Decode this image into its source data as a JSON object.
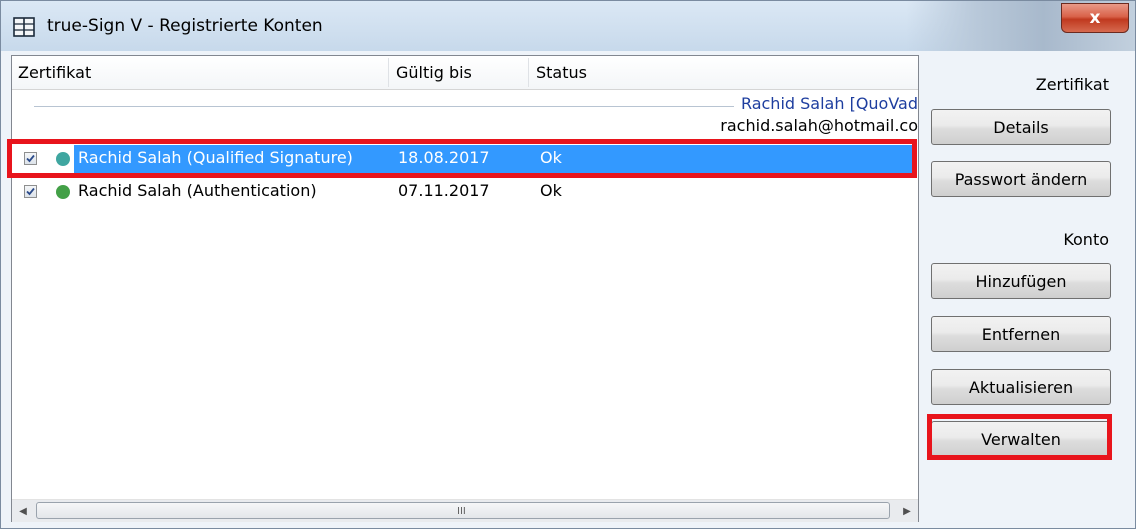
{
  "window": {
    "title": "true-Sign V - Registrierte Konten",
    "close_glyph": "x"
  },
  "list": {
    "columns": [
      {
        "label": "Zertifikat"
      },
      {
        "label": "Gültig bis"
      },
      {
        "label": "Status"
      }
    ],
    "group": {
      "name": "Rachid Salah [QuoVad",
      "email": "rachid.salah@hotmail.co"
    },
    "rows": [
      {
        "name": "Rachid Salah (Qualified Signature)",
        "valid_until": "18.08.2017",
        "status": "Ok",
        "checked": true,
        "selected": true,
        "dot_color": "#3fa6a0"
      },
      {
        "name": "Rachid Salah (Authentication)",
        "valid_until": "07.11.2017",
        "status": "Ok",
        "checked": true,
        "selected": false,
        "dot_color": "#43a047"
      }
    ],
    "scrollbar": {
      "left_arrow": "◀",
      "right_arrow": "▶",
      "grip": "III"
    }
  },
  "panel": {
    "certificate_section": "Zertifikat",
    "details_button": "Details",
    "change_password_button": "Passwort ändern",
    "account_section": "Konto",
    "add_button": "Hinzufügen",
    "remove_button": "Entfernen",
    "update_button": "Aktualisieren",
    "manage_button": "Verwalten"
  },
  "colors": {
    "selection": "#3399ff",
    "highlight": "#e8141c",
    "group_name": "#1e3e9f"
  }
}
